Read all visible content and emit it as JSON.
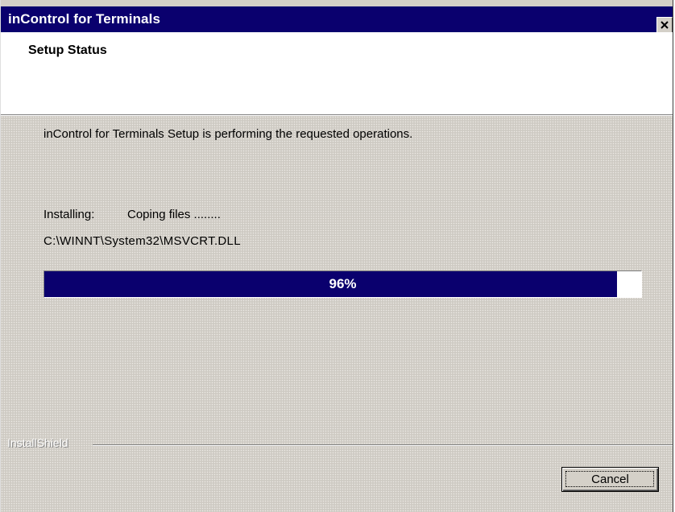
{
  "window": {
    "title": "inControl for Terminals",
    "close_icon": "close-icon",
    "colors": {
      "titlebar": "#0a006e",
      "face": "#d4d0c8",
      "progress_fill": "#0a006e"
    }
  },
  "header": {
    "title": "Setup Status"
  },
  "body": {
    "description": "inControl for Terminals Setup is performing the requested operations.",
    "installing_label": "Installing:",
    "installing_status": "Coping files ........",
    "file_path": "C:\\WINNT\\System32\\MSVCRT.DLL",
    "progress": {
      "percent": 96,
      "label": "96%"
    }
  },
  "footer": {
    "brand": "InstallShield",
    "cancel_label": "Cancel"
  }
}
